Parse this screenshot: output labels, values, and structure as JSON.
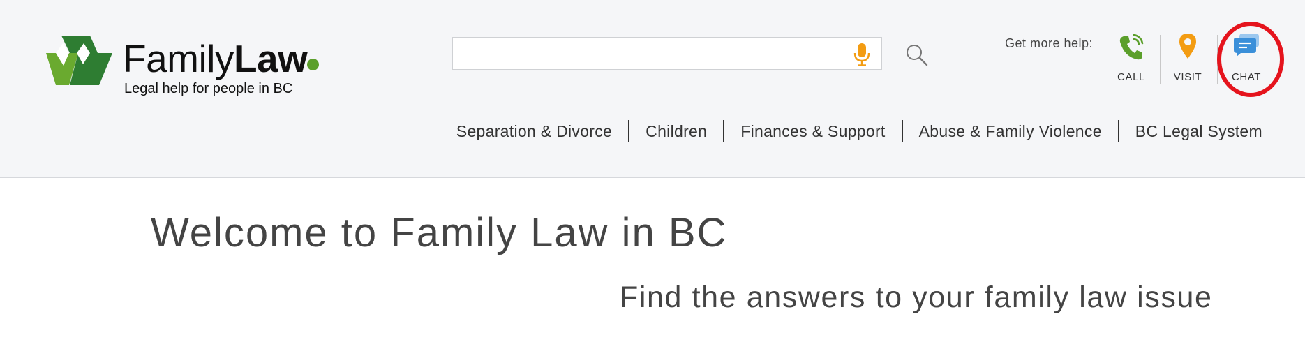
{
  "header": {
    "brand": {
      "name_regular": "Family",
      "name_bold": "Law",
      "tagline": "Legal help for people in BC",
      "colors": {
        "dark_green": "#2e7d32",
        "light_green": "#6aaa2f",
        "dot": "#5b9f2b"
      }
    },
    "search": {
      "placeholder": "",
      "value": "",
      "icons": [
        "microphone-icon",
        "search-icon"
      ],
      "mic_color": "#f39c12"
    },
    "help": {
      "label": "Get more help:",
      "items": [
        {
          "label": "CALL",
          "icon": "phone-icon",
          "color": "#5b9f2b"
        },
        {
          "label": "VISIT",
          "icon": "map-pin-icon",
          "color": "#f39c12"
        },
        {
          "label": "CHAT",
          "icon": "chat-bubble-icon",
          "color": "#3a8fd9"
        }
      ],
      "highlight_color": "#e5141d"
    },
    "nav": [
      {
        "label": "Separation & Divorce"
      },
      {
        "label": "Children"
      },
      {
        "label": "Finances & Support"
      },
      {
        "label": "Abuse & Family Violence"
      },
      {
        "label": "BC Legal System"
      }
    ]
  },
  "main": {
    "title": "Welcome to Family Law in BC",
    "subtitle": "Find the answers to your family law issue"
  }
}
